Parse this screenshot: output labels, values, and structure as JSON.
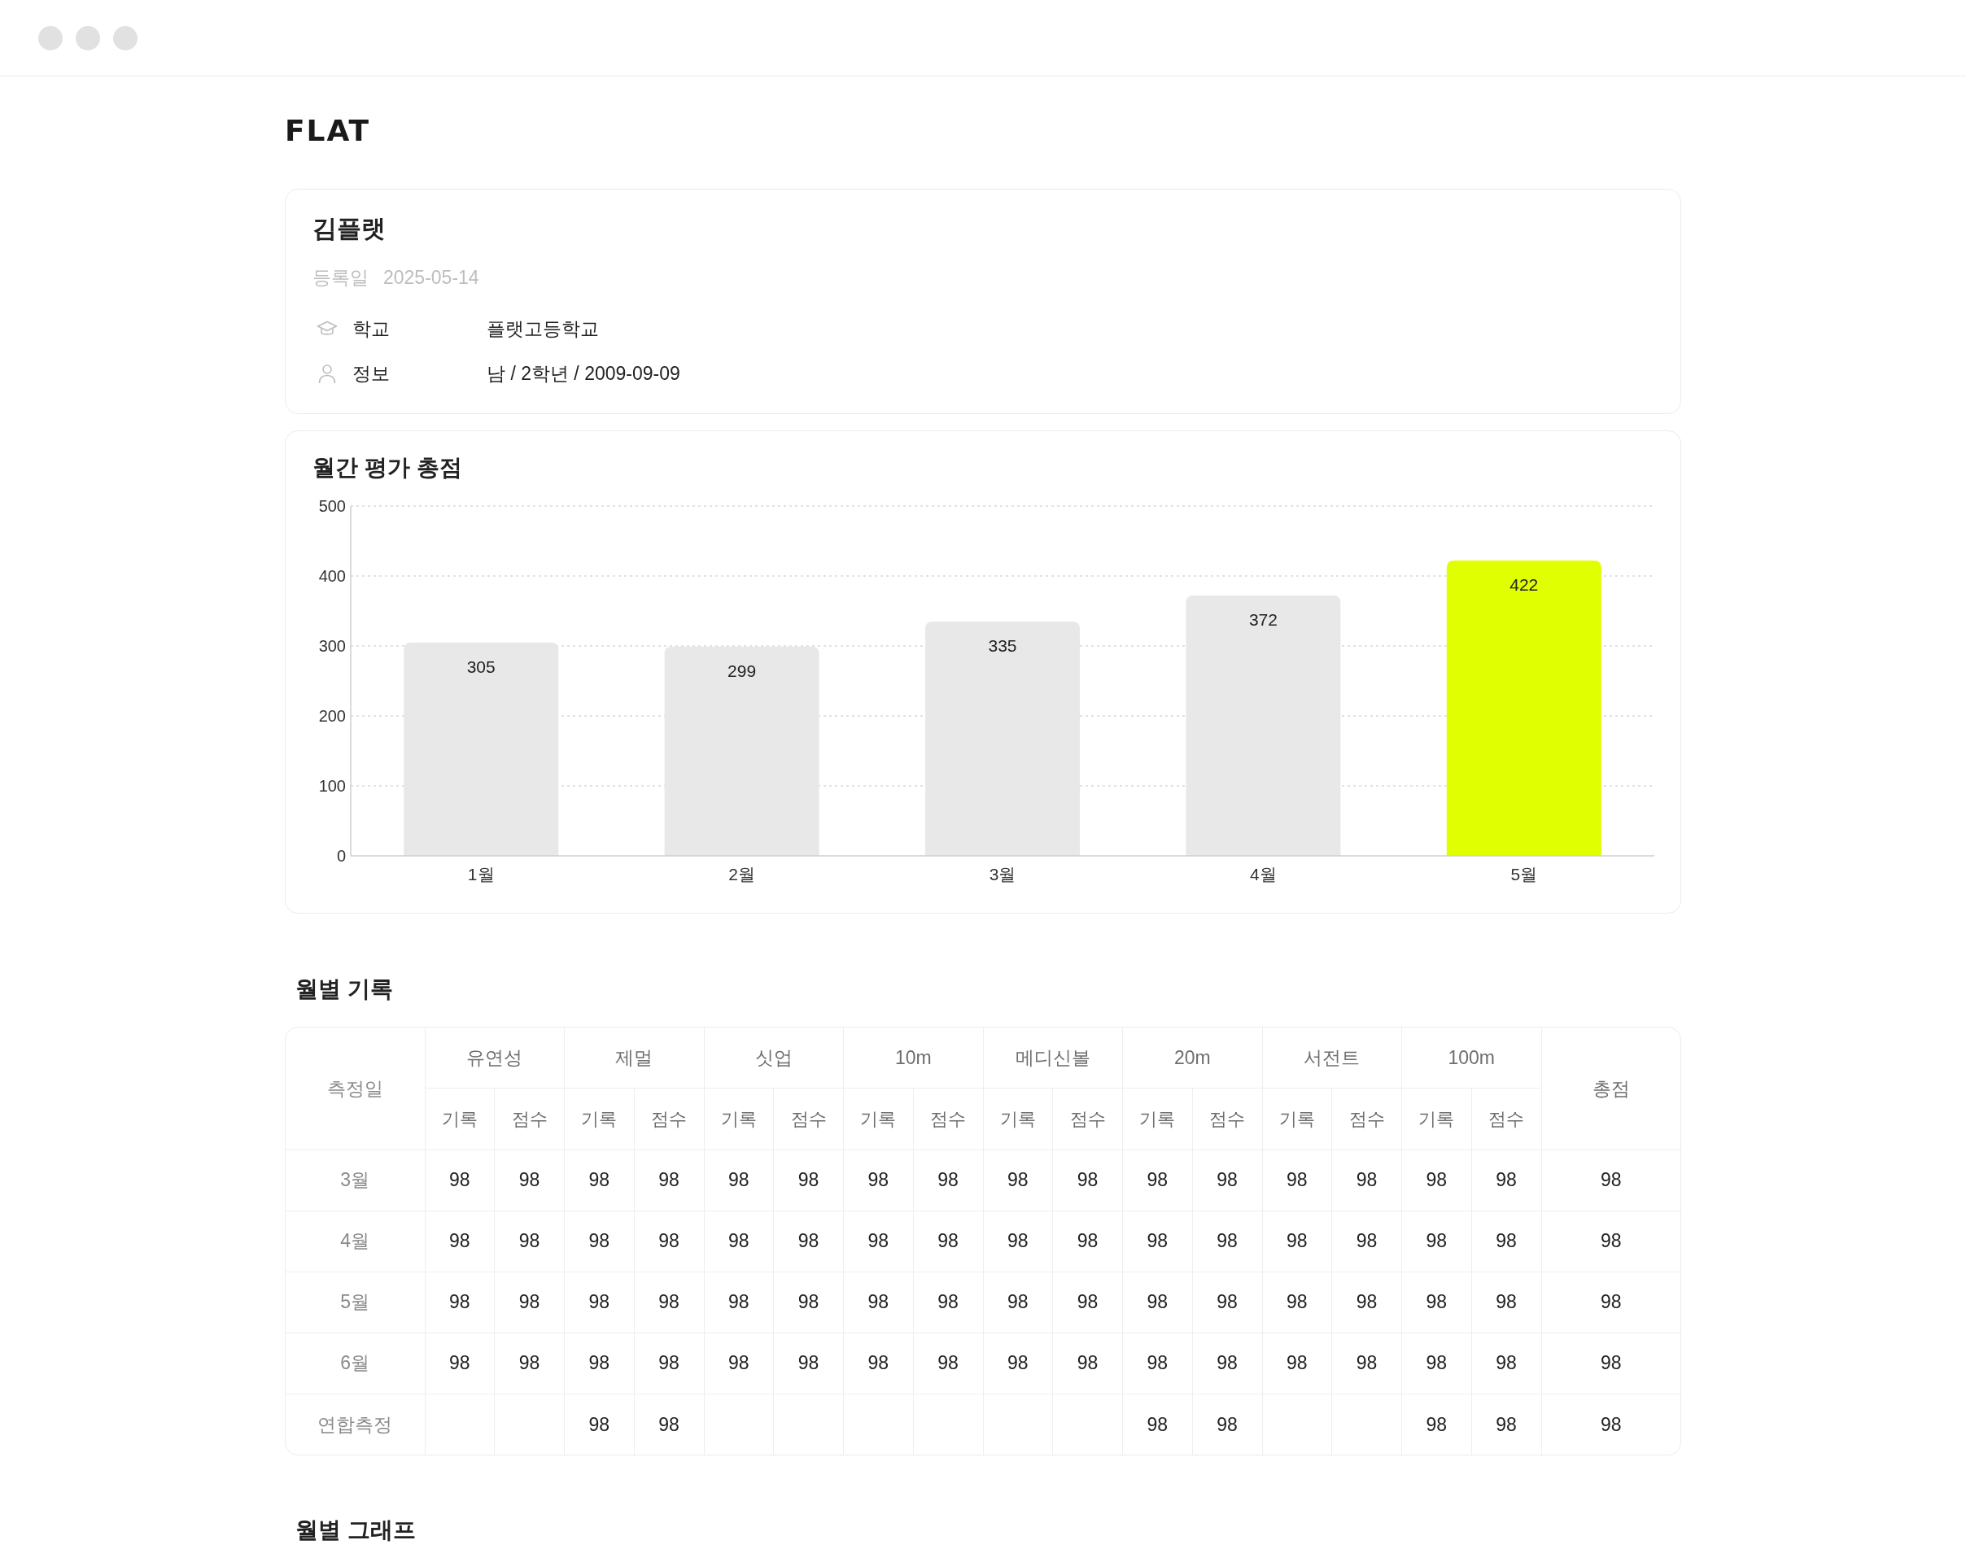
{
  "logo": "FLAT",
  "profile": {
    "name": "김플랫",
    "registered": {
      "label": "등록일",
      "value": "2025-05-14"
    },
    "rows": [
      {
        "kind": "school",
        "label": "학교",
        "value": "플랫고등학교"
      },
      {
        "kind": "person",
        "label": "정보",
        "value": "남 / 2학년 / 2009-09-09"
      }
    ]
  },
  "monthly_total": {
    "title": "월간 평가 총점",
    "chart_data": {
      "type": "bar",
      "categories": [
        "1월",
        "2월",
        "3월",
        "4월",
        "5월"
      ],
      "values": [
        305,
        299,
        335,
        372,
        422
      ],
      "colors": [
        "#e8e8e8",
        "#e8e8e8",
        "#e8e8e8",
        "#e8e8e8",
        "#e0ff00"
      ],
      "ylim": [
        0,
        500
      ],
      "yticks": [
        0,
        100,
        200,
        300,
        400,
        500
      ],
      "grid": true,
      "data_labels": true
    }
  },
  "monthly_records": {
    "title": "월별 기록",
    "table": {
      "date_header": "측정일",
      "total_header": "총점",
      "groups": [
        {
          "label": "유연성",
          "sub_headers": [
            "기록",
            "점수"
          ]
        },
        {
          "label": "제멀",
          "sub_headers": [
            "기록",
            "점수"
          ]
        },
        {
          "label": "싯업",
          "sub_headers": [
            "기록",
            "점수"
          ]
        },
        {
          "label": "10m",
          "sub_headers": [
            "기록",
            "점수"
          ]
        },
        {
          "label": "메디신볼",
          "sub_headers": [
            "기록",
            "점수"
          ]
        },
        {
          "label": "20m",
          "sub_headers": [
            "기록",
            "점수"
          ]
        },
        {
          "label": "서전트",
          "sub_headers": [
            "기록",
            "점수"
          ]
        },
        {
          "label": "100m",
          "sub_headers": [
            "기록",
            "점수"
          ]
        }
      ],
      "rows": [
        {
          "label": "3월",
          "cells": [
            "98",
            "98",
            "98",
            "98",
            "98",
            "98",
            "98",
            "98",
            "98",
            "98",
            "98",
            "98",
            "98",
            "98",
            "98",
            "98"
          ],
          "total": "98"
        },
        {
          "label": "4월",
          "cells": [
            "98",
            "98",
            "98",
            "98",
            "98",
            "98",
            "98",
            "98",
            "98",
            "98",
            "98",
            "98",
            "98",
            "98",
            "98",
            "98"
          ],
          "total": "98"
        },
        {
          "label": "5월",
          "cells": [
            "98",
            "98",
            "98",
            "98",
            "98",
            "98",
            "98",
            "98",
            "98",
            "98",
            "98",
            "98",
            "98",
            "98",
            "98",
            "98"
          ],
          "total": "98"
        },
        {
          "label": "6월",
          "cells": [
            "98",
            "98",
            "98",
            "98",
            "98",
            "98",
            "98",
            "98",
            "98",
            "98",
            "98",
            "98",
            "98",
            "98",
            "98",
            "98"
          ],
          "total": "98"
        },
        {
          "label": "연합측정",
          "cells": [
            null,
            null,
            "98",
            "98",
            null,
            null,
            null,
            null,
            null,
            null,
            "98",
            "98",
            null,
            null,
            "98",
            "98"
          ],
          "total": "98"
        }
      ]
    }
  },
  "monthly_graph": {
    "title": "월별 그래프"
  }
}
